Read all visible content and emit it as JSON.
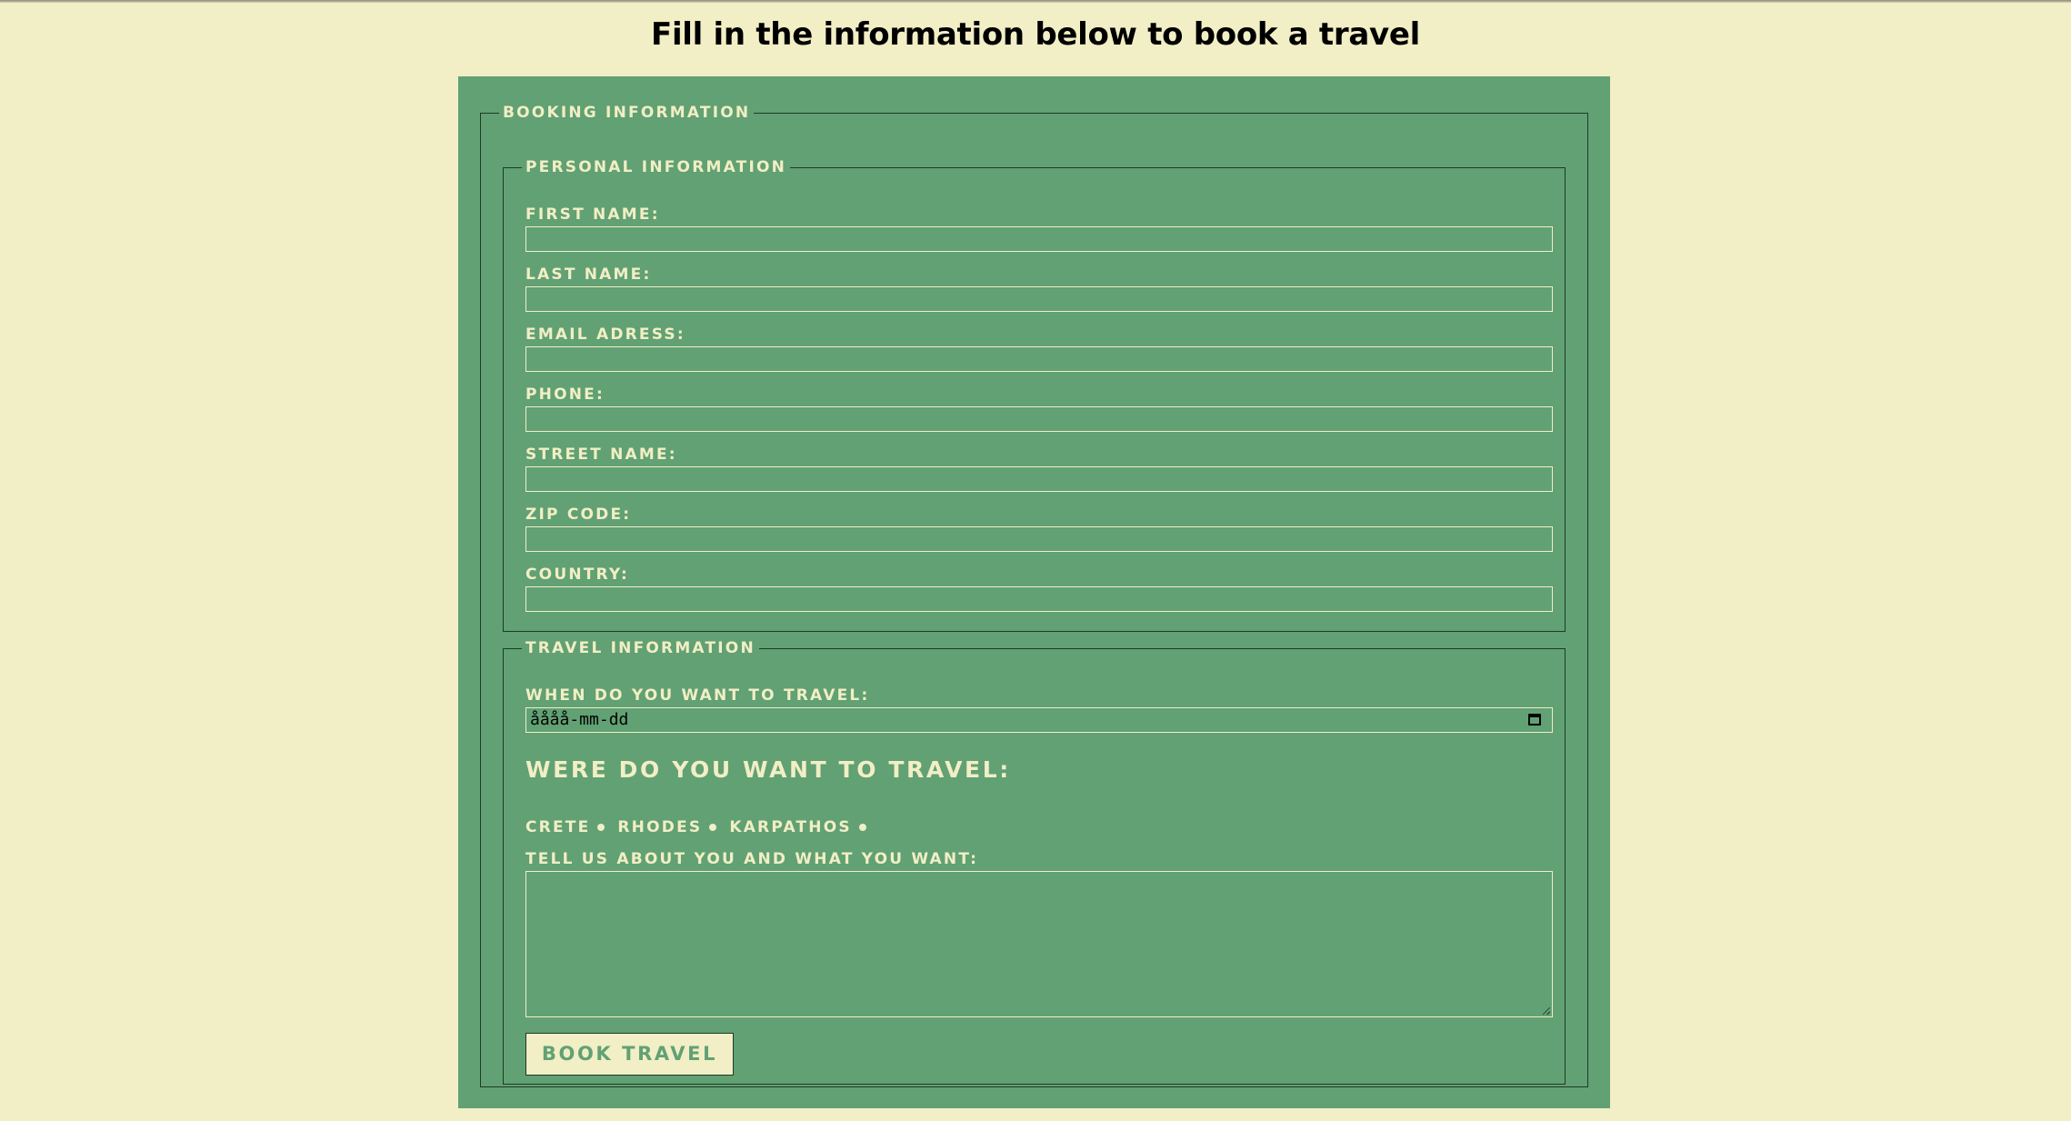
{
  "page": {
    "title": "Fill in the information below to book a travel"
  },
  "booking": {
    "legend": "BOOKING INFORMATION",
    "personal": {
      "legend": "PERSONAL INFORMATION",
      "fields": [
        {
          "label": "FIRST NAME:",
          "value": ""
        },
        {
          "label": "LAST NAME:",
          "value": ""
        },
        {
          "label": "EMAIL ADRESS:",
          "value": ""
        },
        {
          "label": "PHONE:",
          "value": ""
        },
        {
          "label": "STREET NAME:",
          "value": ""
        },
        {
          "label": "ZIP CODE:",
          "value": ""
        },
        {
          "label": "COUNTRY:",
          "value": ""
        }
      ]
    },
    "travel": {
      "legend": "TRAVEL INFORMATION",
      "date_label": "WHEN DO YOU WANT TO TRAVEL:",
      "date_placeholder": "åååå-mm-dd",
      "destination_heading": "WERE DO YOU WANT TO TRAVEL:",
      "destinations": [
        "CRETE",
        "RHODES",
        "KARPATHOS"
      ],
      "about_label": "TELL US ABOUT YOU AND WHAT YOU WANT:",
      "about_value": "",
      "submit_label": "BOOK TRAVEL"
    }
  },
  "colors": {
    "background": "#f2eec5",
    "panel": "#61a174",
    "border": "#1f3a26",
    "text_light": "#f2eec5"
  },
  "icons": {
    "date_picker": "calendar-icon"
  }
}
